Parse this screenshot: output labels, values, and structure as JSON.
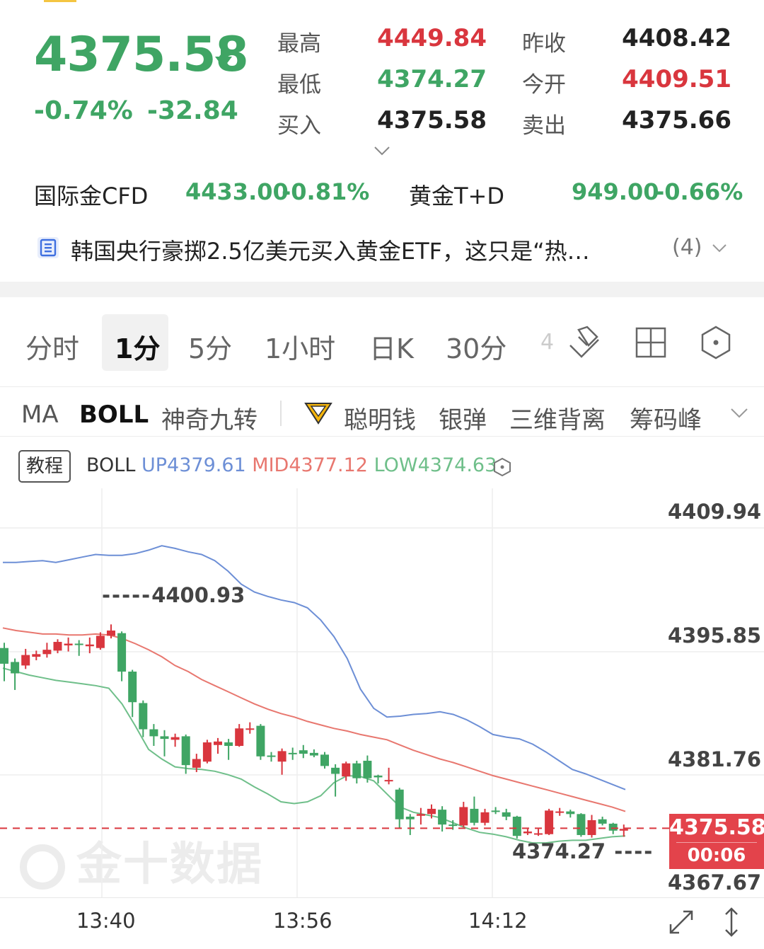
{
  "quote": {
    "price": "4375.58",
    "change_pct": "-0.74%",
    "change_abs": "-32.84",
    "stats": [
      {
        "label": "最高",
        "value": "4449.84",
        "color": "red"
      },
      {
        "label": "昨收",
        "value": "4408.42",
        "color": "dark"
      },
      {
        "label": "最低",
        "value": "4374.27",
        "color": "green"
      },
      {
        "label": "今开",
        "value": "4409.51",
        "color": "red"
      },
      {
        "label": "买入",
        "value": "4375.58",
        "color": "dark"
      },
      {
        "label": "卖出",
        "value": "4375.66",
        "color": "dark"
      }
    ]
  },
  "related": [
    {
      "name": "国际金CFD",
      "price": "4433.00",
      "pct": "-0.81%"
    },
    {
      "name": "黄金T+D",
      "price": "949.00",
      "pct": "-0.66%"
    }
  ],
  "news": {
    "text": "韩国央行豪掷2.5亿美元买入黄金ETF，这只是“热…",
    "count": "(4)"
  },
  "tabs": [
    "分时",
    "1分",
    "5分",
    "1小时",
    "日K",
    "30分"
  ],
  "tab_more": "4",
  "active_tab": "1分",
  "indicators": [
    "MA",
    "BOLL",
    "神奇九转",
    "聪明钱",
    "银弹",
    "三维背离",
    "筹码峰"
  ],
  "active_indicator": "BOLL",
  "tutorial_label": "教程",
  "boll": {
    "name": "BOLL",
    "up": "UP4379.61",
    "mid": "MID4377.12",
    "low": "LOW4374.63"
  },
  "chart_data": {
    "type": "candlestick",
    "title": "",
    "y_axis_labels": [
      "4409.94",
      "4395.85",
      "4381.76",
      "4367.67"
    ],
    "x_axis_labels": [
      "13:40",
      "13:56",
      "14:12"
    ],
    "ylim": [
      4367.67,
      4409.94
    ],
    "high_marker": "4400.93",
    "low_marker": "4374.27",
    "last_price": "4375.58",
    "countdown": "00:06",
    "colors": {
      "up": "#d9363e",
      "down": "#3fa564",
      "boll_up": "#6d8fd6",
      "boll_mid": "#e8776f",
      "boll_low": "#6fbf8a"
    },
    "candles": [
      {
        "o": 4396.2,
        "c": 4394.4,
        "h": 4396.8,
        "l": 4392.4
      },
      {
        "o": 4394.6,
        "c": 4393.3,
        "h": 4395.0,
        "l": 4391.4
      },
      {
        "o": 4394.2,
        "c": 4395.4,
        "h": 4396.1,
        "l": 4393.8
      },
      {
        "o": 4395.2,
        "c": 4395.5,
        "h": 4395.9,
        "l": 4394.8
      },
      {
        "o": 4395.5,
        "c": 4396.0,
        "h": 4396.8,
        "l": 4395.1
      },
      {
        "o": 4395.9,
        "c": 4396.9,
        "h": 4397.2,
        "l": 4395.6
      },
      {
        "o": 4396.5,
        "c": 4396.7,
        "h": 4397.4,
        "l": 4395.8
      },
      {
        "o": 4396.7,
        "c": 4396.6,
        "h": 4397.1,
        "l": 4395.3
      },
      {
        "o": 4396.4,
        "c": 4396.6,
        "h": 4397.4,
        "l": 4395.6
      },
      {
        "o": 4396.2,
        "c": 4397.6,
        "h": 4398.0,
        "l": 4396.0
      },
      {
        "o": 4397.6,
        "c": 4398.2,
        "h": 4398.9,
        "l": 4397.3
      },
      {
        "o": 4397.9,
        "c": 4393.5,
        "h": 4398.1,
        "l": 4392.4
      },
      {
        "o": 4393.5,
        "c": 4390.0,
        "h": 4393.7,
        "l": 4388.3
      },
      {
        "o": 4389.9,
        "c": 4386.9,
        "h": 4390.2,
        "l": 4386.0
      },
      {
        "o": 4386.9,
        "c": 4386.1,
        "h": 4387.5,
        "l": 4385.0
      },
      {
        "o": 4386.1,
        "c": 4385.8,
        "h": 4386.8,
        "l": 4383.8
      },
      {
        "o": 4385.7,
        "c": 4386.0,
        "h": 4386.4,
        "l": 4384.9
      },
      {
        "o": 4386.1,
        "c": 4382.8,
        "h": 4386.3,
        "l": 4381.8
      },
      {
        "o": 4382.5,
        "c": 4383.5,
        "h": 4384.1,
        "l": 4382.0
      },
      {
        "o": 4383.2,
        "c": 4385.4,
        "h": 4385.7,
        "l": 4383.0
      },
      {
        "o": 4385.1,
        "c": 4385.5,
        "h": 4385.9,
        "l": 4384.1
      },
      {
        "o": 4385.4,
        "c": 4385.0,
        "h": 4385.8,
        "l": 4383.4
      },
      {
        "o": 4385.0,
        "c": 4387.0,
        "h": 4387.5,
        "l": 4384.9
      },
      {
        "o": 4387.0,
        "c": 4387.0,
        "h": 4387.7,
        "l": 4386.4
      },
      {
        "o": 4387.3,
        "c": 4383.8,
        "h": 4387.5,
        "l": 4383.4
      },
      {
        "o": 4383.9,
        "c": 4383.8,
        "h": 4384.3,
        "l": 4383.2
      },
      {
        "o": 4383.2,
        "c": 4384.4,
        "h": 4384.7,
        "l": 4381.7
      },
      {
        "o": 4384.2,
        "c": 4384.1,
        "h": 4384.8,
        "l": 4383.4
      },
      {
        "o": 4384.5,
        "c": 4384.1,
        "h": 4385.1,
        "l": 4383.6
      },
      {
        "o": 4384.2,
        "c": 4383.9,
        "h": 4384.6,
        "l": 4383.7
      },
      {
        "o": 4384.0,
        "c": 4382.7,
        "h": 4384.3,
        "l": 4382.4
      },
      {
        "o": 4382.5,
        "c": 4381.8,
        "h": 4382.9,
        "l": 4379.2
      },
      {
        "o": 4381.5,
        "c": 4383.0,
        "h": 4383.2,
        "l": 4381.0
      },
      {
        "o": 4383.0,
        "c": 4381.3,
        "h": 4383.3,
        "l": 4380.7
      },
      {
        "o": 4383.3,
        "c": 4381.3,
        "h": 4383.9,
        "l": 4380.8
      },
      {
        "o": 4381.6,
        "c": 4381.4,
        "h": 4381.7,
        "l": 4380.7
      },
      {
        "o": 4381.1,
        "c": 4381.1,
        "h": 4382.5,
        "l": 4380.6
      },
      {
        "o": 4380.0,
        "c": 4376.6,
        "h": 4380.2,
        "l": 4375.6
      },
      {
        "o": 4376.9,
        "c": 4376.6,
        "h": 4377.2,
        "l": 4374.8
      },
      {
        "o": 4377.0,
        "c": 4377.2,
        "h": 4377.9,
        "l": 4376.0
      },
      {
        "o": 4377.2,
        "c": 4377.8,
        "h": 4378.3,
        "l": 4376.7
      },
      {
        "o": 4377.7,
        "c": 4376.0,
        "h": 4378.1,
        "l": 4375.2
      },
      {
        "o": 4376.0,
        "c": 4375.9,
        "h": 4376.5,
        "l": 4375.4
      },
      {
        "o": 4375.9,
        "c": 4378.0,
        "h": 4378.6,
        "l": 4375.7
      },
      {
        "o": 4377.8,
        "c": 4376.2,
        "h": 4379.2,
        "l": 4375.9
      },
      {
        "o": 4376.2,
        "c": 4377.4,
        "h": 4377.8,
        "l": 4375.9
      },
      {
        "o": 4377.6,
        "c": 4377.5,
        "h": 4378.0,
        "l": 4377.2
      },
      {
        "o": 4377.4,
        "c": 4376.9,
        "h": 4377.8,
        "l": 4376.5
      },
      {
        "o": 4376.9,
        "c": 4374.7,
        "h": 4377.0,
        "l": 4374.4
      },
      {
        "o": 4375.0,
        "c": 4375.2,
        "h": 4375.5,
        "l": 4374.8
      },
      {
        "o": 4375.0,
        "c": 4375.0,
        "h": 4375.5,
        "l": 4374.7
      },
      {
        "o": 4374.9,
        "c": 4377.6,
        "h": 4377.8,
        "l": 4374.8
      },
      {
        "o": 4377.4,
        "c": 4377.5,
        "h": 4377.9,
        "l": 4377.0
      },
      {
        "o": 4377.5,
        "c": 4377.2,
        "h": 4377.7,
        "l": 4376.8
      },
      {
        "o": 4377.2,
        "c": 4374.8,
        "h": 4377.3,
        "l": 4374.6
      },
      {
        "o": 4374.8,
        "c": 4376.5,
        "h": 4377.1,
        "l": 4374.5
      },
      {
        "o": 4376.6,
        "c": 4376.1,
        "h": 4376.9,
        "l": 4375.9
      },
      {
        "o": 4376.1,
        "c": 4375.3,
        "h": 4376.2,
        "l": 4374.9
      },
      {
        "o": 4375.3,
        "c": 4375.5,
        "h": 4376.0,
        "l": 4374.6
      }
    ],
    "boll_upper": [
      4406.0,
      4406.0,
      4406.1,
      4406.2,
      4406.0,
      4406.3,
      4406.6,
      4406.9,
      4406.8,
      4406.8,
      4407.0,
      4407.4,
      4407.9,
      4407.6,
      4407.2,
      4406.9,
      4406.2,
      4405.0,
      4403.5,
      4402.6,
      4402.1,
      4401.7,
      4401.4,
      4400.8,
      4399.4,
      4397.5,
      4395.0,
      4391.5,
      4389.3,
      4388.3,
      4388.4,
      4388.6,
      4388.7,
      4388.9,
      4388.6,
      4388.0,
      4387.2,
      4386.3,
      4386.0,
      4385.8,
      4385.2,
      4384.3,
      4383.3,
      4382.3,
      4381.8,
      4381.2,
      4380.6,
      4380.0
    ],
    "boll_mid": [
      4398.5,
      4398.2,
      4398.0,
      4397.8,
      4397.8,
      4397.7,
      4397.7,
      4397.8,
      4397.7,
      4397.3,
      4396.7,
      4396.0,
      4395.2,
      4394.2,
      4393.5,
      4392.6,
      4391.9,
      4391.2,
      4390.5,
      4389.8,
      4389.2,
      4388.7,
      4388.3,
      4387.8,
      4387.4,
      4387.0,
      4386.7,
      4386.3,
      4386.0,
      4385.7,
      4385.1,
      4384.5,
      4384.0,
      4383.5,
      4383.1,
      4382.6,
      4382.1,
      4381.6,
      4381.2,
      4380.8,
      4380.4,
      4380.0,
      4379.6,
      4379.2,
      4378.8,
      4378.4,
      4378.0,
      4377.5
    ],
    "boll_lower": [
      4393.9,
      4393.5,
      4393.1,
      4392.8,
      4392.5,
      4392.3,
      4392.1,
      4391.9,
      4391.6,
      4389.8,
      4387.3,
      4384.6,
      4383.5,
      4382.6,
      4382.4,
      4382.3,
      4382.1,
      4381.7,
      4381.2,
      4380.3,
      4379.5,
      4378.6,
      4378.4,
      4378.6,
      4379.3,
      4380.8,
      4381.6,
      4381.5,
      4381.0,
      4379.5,
      4378.0,
      4377.4,
      4377.1,
      4376.8,
      4376.2,
      4375.6,
      4375.1,
      4374.9,
      4374.6,
      4374.2,
      4373.9,
      4373.9,
      4374.1,
      4374.2,
      4374.2,
      4374.4,
      4374.6,
      4374.7
    ]
  }
}
